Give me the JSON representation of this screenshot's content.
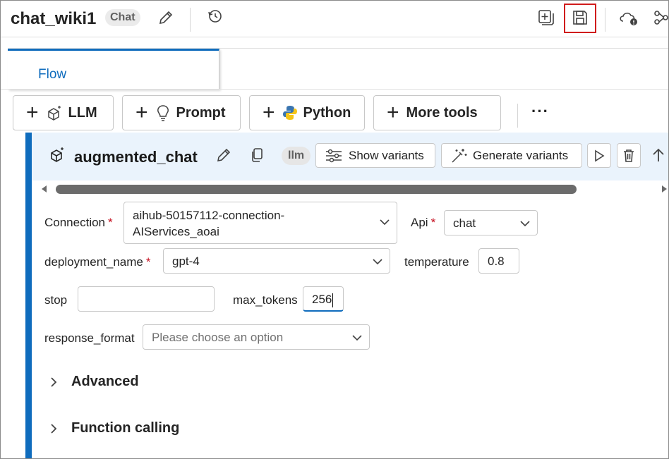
{
  "header": {
    "title": "chat_wiki1",
    "badge": "Chat",
    "icons": [
      "edit-icon",
      "history-icon",
      "add-page-icon",
      "save-icon",
      "cloud-status-icon",
      "graph-icon"
    ]
  },
  "tabs": [
    {
      "label": "Flow",
      "active": true
    }
  ],
  "toolbar": {
    "buttons": [
      {
        "label": "LLM",
        "icon": "llm-sparkle-icon"
      },
      {
        "label": "Prompt",
        "icon": "lightbulb-icon"
      },
      {
        "label": "Python",
        "icon": "python-icon"
      },
      {
        "label": "More tools",
        "icon": ""
      }
    ],
    "overflow": "···"
  },
  "node": {
    "name": "augmented_chat",
    "type_badge": "llm",
    "show_variants": "Show variants",
    "generate_variants": "Generate variants"
  },
  "form": {
    "connection_label": "Connection",
    "connection_value_line1": "aihub-50157112-connection-",
    "connection_value_line2": "AIServices_aoai",
    "api_label": "Api",
    "api_value": "chat",
    "deployment_label": "deployment_name",
    "deployment_value": "gpt-4",
    "temperature_label": "temperature",
    "temperature_value": "0.8",
    "stop_label": "stop",
    "stop_value": "",
    "max_tokens_label": "max_tokens",
    "max_tokens_value": "256",
    "response_format_label": "response_format",
    "response_format_placeholder": "Please choose an option",
    "required_mark": "*"
  },
  "sections": {
    "advanced": "Advanced",
    "function_calling": "Function calling"
  },
  "colors": {
    "accent": "#0f6cbd",
    "node_header_bg": "#eaf3fc",
    "save_highlight": "#d01c1c",
    "required": "#c50f1f"
  }
}
